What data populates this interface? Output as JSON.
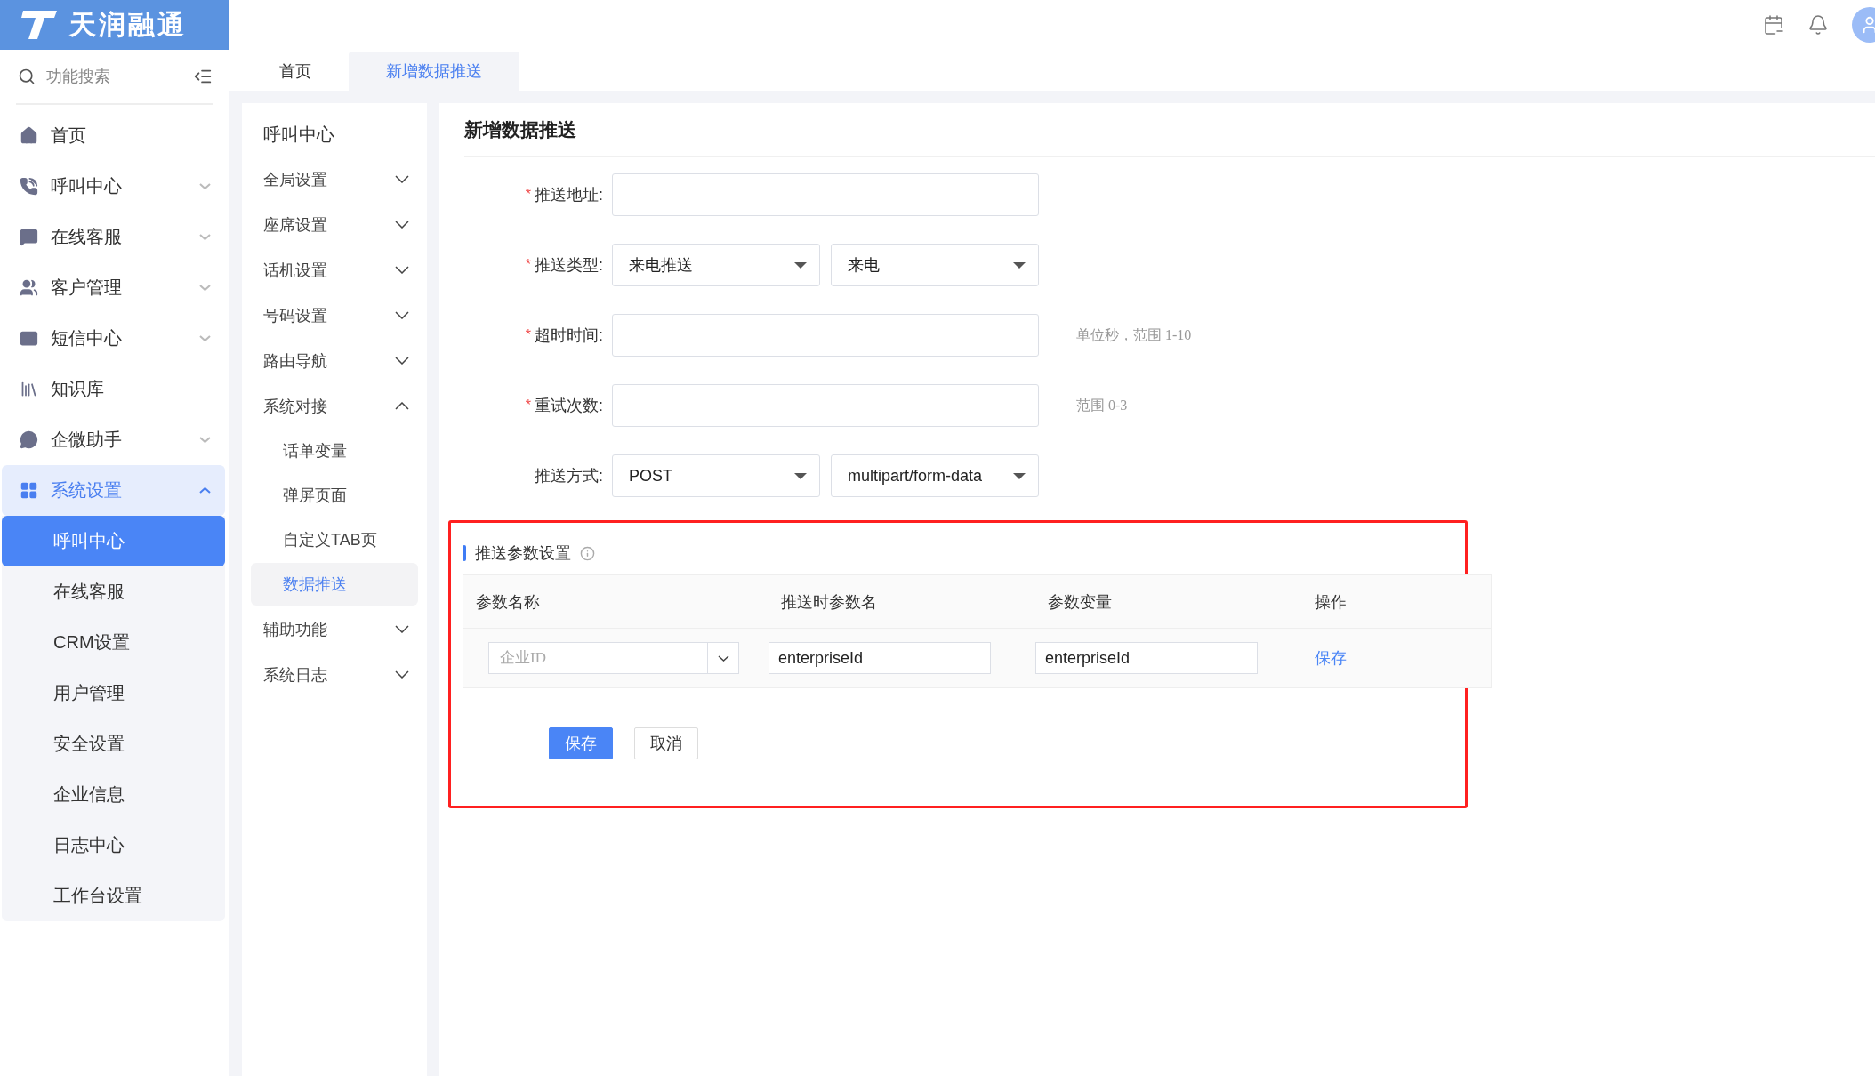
{
  "header": {
    "logo_text": "天润融通"
  },
  "sidebar": {
    "search_placeholder": "功能搜索",
    "items": [
      {
        "label": "首页",
        "kind": "link"
      },
      {
        "label": "呼叫中心",
        "kind": "group",
        "expanded": false
      },
      {
        "label": "在线客服",
        "kind": "group",
        "expanded": false
      },
      {
        "label": "客户管理",
        "kind": "group",
        "expanded": false
      },
      {
        "label": "短信中心",
        "kind": "group",
        "expanded": false
      },
      {
        "label": "知识库",
        "kind": "link"
      },
      {
        "label": "企微助手",
        "kind": "group",
        "expanded": false
      },
      {
        "label": "系统设置",
        "kind": "group",
        "expanded": true,
        "children": [
          {
            "label": "呼叫中心",
            "selected": true
          },
          {
            "label": "在线客服",
            "selected": false
          },
          {
            "label": "CRM设置",
            "selected": false
          },
          {
            "label": "用户管理",
            "selected": false
          },
          {
            "label": "安全设置",
            "selected": false
          },
          {
            "label": "企业信息",
            "selected": false
          },
          {
            "label": "日志中心",
            "selected": false
          },
          {
            "label": "工作台设置",
            "selected": false
          }
        ]
      }
    ]
  },
  "tabs": [
    {
      "label": "首页",
      "selected": false
    },
    {
      "label": "新增数据推送",
      "selected": true
    }
  ],
  "subnav": {
    "title": "呼叫中心",
    "items": [
      {
        "label": "全局设置",
        "expanded": false
      },
      {
        "label": "座席设置",
        "expanded": false
      },
      {
        "label": "话机设置",
        "expanded": false
      },
      {
        "label": "号码设置",
        "expanded": false
      },
      {
        "label": "路由导航",
        "expanded": false
      },
      {
        "label": "系统对接",
        "expanded": true,
        "children": [
          {
            "label": "话单变量",
            "selected": false
          },
          {
            "label": "弹屏页面",
            "selected": false
          },
          {
            "label": "自定义TAB页",
            "selected": false
          },
          {
            "label": "数据推送",
            "selected": true
          }
        ]
      },
      {
        "label": "辅助功能",
        "expanded": false
      },
      {
        "label": "系统日志",
        "expanded": false
      }
    ]
  },
  "form": {
    "title": "新增数据推送",
    "fields": [
      {
        "label": "推送地址:",
        "required_mark": "*",
        "kind": "input"
      },
      {
        "label": "推送类型:",
        "required_mark": "*",
        "kind": "selects",
        "values": [
          "来电推送",
          "来电"
        ]
      },
      {
        "label": "超时时间:",
        "required_mark": "*",
        "kind": "input",
        "hint": "单位秒，范围 1-10"
      },
      {
        "label": "重试次数:",
        "required_mark": "*",
        "kind": "input",
        "hint": "范围 0-3"
      },
      {
        "label": "推送方式:",
        "kind": "selects",
        "values": [
          "POST",
          "multipart/form-data"
        ]
      }
    ]
  },
  "params": {
    "title": "推送参数设置",
    "columns": [
      "参数名称",
      "推送时参数名",
      "参数变量",
      "操作"
    ],
    "rows": [
      {
        "name_placeholder": "企业ID",
        "push_name": "enterpriseId",
        "variable": "enterpriseId",
        "action": "保存"
      }
    ]
  },
  "buttons": [
    {
      "label": "保存",
      "kind": "primary"
    },
    {
      "label": "取消",
      "kind": "default"
    }
  ]
}
